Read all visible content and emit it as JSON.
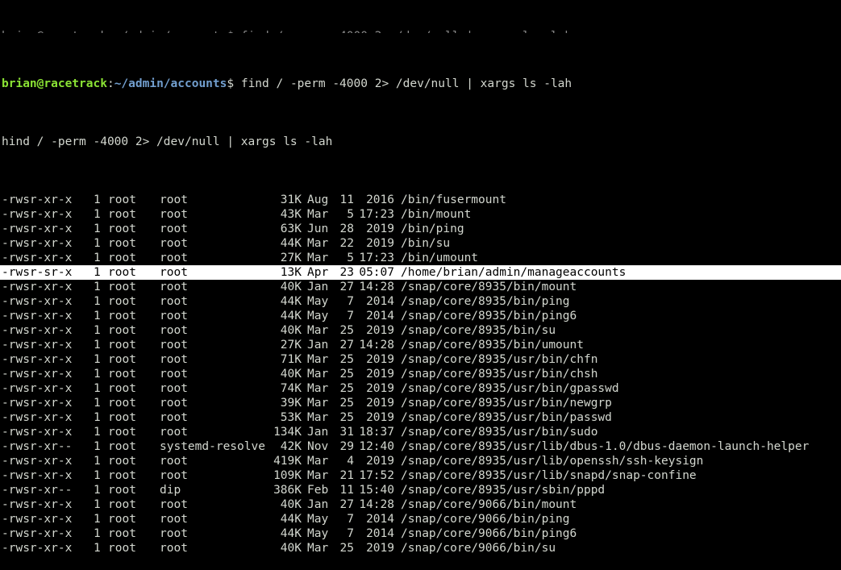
{
  "prompt": {
    "user_host": "brian@racetrack",
    "separator": ":",
    "path": "~/admin/accounts",
    "symbol": "$ ",
    "command": "find / -perm -4000 2> /dev/null | xargs ls -lah"
  },
  "echo_line": "hind / -perm -4000 2> /dev/null | xargs ls -lah",
  "partial_line": "brian@racetrack:~/admin/accounts$ find / -perm -4000 2> /dev/null | xargs ls -lah",
  "rows": [
    {
      "perm": "-rwsr-xr-x",
      "links": "1",
      "owner": "root",
      "group": "root",
      "size": "31K",
      "month": "Aug",
      "day": "11",
      "time": "2016",
      "path": "/bin/fusermount"
    },
    {
      "perm": "-rwsr-xr-x",
      "links": "1",
      "owner": "root",
      "group": "root",
      "size": "43K",
      "month": "Mar",
      "day": "5",
      "time": "17:23",
      "path": "/bin/mount"
    },
    {
      "perm": "-rwsr-xr-x",
      "links": "1",
      "owner": "root",
      "group": "root",
      "size": "63K",
      "month": "Jun",
      "day": "28",
      "time": "2019",
      "path": "/bin/ping"
    },
    {
      "perm": "-rwsr-xr-x",
      "links": "1",
      "owner": "root",
      "group": "root",
      "size": "44K",
      "month": "Mar",
      "day": "22",
      "time": "2019",
      "path": "/bin/su"
    },
    {
      "perm": "-rwsr-xr-x",
      "links": "1",
      "owner": "root",
      "group": "root",
      "size": "27K",
      "month": "Mar",
      "day": "5",
      "time": "17:23",
      "path": "/bin/umount"
    },
    {
      "perm": "-rwsr-sr-x",
      "links": "1",
      "owner": "root",
      "group": "root",
      "size": "13K",
      "month": "Apr",
      "day": "23",
      "time": "05:07",
      "path": "/home/brian/admin/manageaccounts",
      "highlight": true
    },
    {
      "perm": "-rwsr-xr-x",
      "links": "1",
      "owner": "root",
      "group": "root",
      "size": "40K",
      "month": "Jan",
      "day": "27",
      "time": "14:28",
      "path": "/snap/core/8935/bin/mount"
    },
    {
      "perm": "-rwsr-xr-x",
      "links": "1",
      "owner": "root",
      "group": "root",
      "size": "44K",
      "month": "May",
      "day": "7",
      "time": "2014",
      "path": "/snap/core/8935/bin/ping"
    },
    {
      "perm": "-rwsr-xr-x",
      "links": "1",
      "owner": "root",
      "group": "root",
      "size": "44K",
      "month": "May",
      "day": "7",
      "time": "2014",
      "path": "/snap/core/8935/bin/ping6"
    },
    {
      "perm": "-rwsr-xr-x",
      "links": "1",
      "owner": "root",
      "group": "root",
      "size": "40K",
      "month": "Mar",
      "day": "25",
      "time": "2019",
      "path": "/snap/core/8935/bin/su"
    },
    {
      "perm": "-rwsr-xr-x",
      "links": "1",
      "owner": "root",
      "group": "root",
      "size": "27K",
      "month": "Jan",
      "day": "27",
      "time": "14:28",
      "path": "/snap/core/8935/bin/umount"
    },
    {
      "perm": "-rwsr-xr-x",
      "links": "1",
      "owner": "root",
      "group": "root",
      "size": "71K",
      "month": "Mar",
      "day": "25",
      "time": "2019",
      "path": "/snap/core/8935/usr/bin/chfn"
    },
    {
      "perm": "-rwsr-xr-x",
      "links": "1",
      "owner": "root",
      "group": "root",
      "size": "40K",
      "month": "Mar",
      "day": "25",
      "time": "2019",
      "path": "/snap/core/8935/usr/bin/chsh"
    },
    {
      "perm": "-rwsr-xr-x",
      "links": "1",
      "owner": "root",
      "group": "root",
      "size": "74K",
      "month": "Mar",
      "day": "25",
      "time": "2019",
      "path": "/snap/core/8935/usr/bin/gpasswd"
    },
    {
      "perm": "-rwsr-xr-x",
      "links": "1",
      "owner": "root",
      "group": "root",
      "size": "39K",
      "month": "Mar",
      "day": "25",
      "time": "2019",
      "path": "/snap/core/8935/usr/bin/newgrp"
    },
    {
      "perm": "-rwsr-xr-x",
      "links": "1",
      "owner": "root",
      "group": "root",
      "size": "53K",
      "month": "Mar",
      "day": "25",
      "time": "2019",
      "path": "/snap/core/8935/usr/bin/passwd"
    },
    {
      "perm": "-rwsr-xr-x",
      "links": "1",
      "owner": "root",
      "group": "root",
      "size": "134K",
      "month": "Jan",
      "day": "31",
      "time": "18:37",
      "path": "/snap/core/8935/usr/bin/sudo"
    },
    {
      "perm": "-rwsr-xr--",
      "links": "1",
      "owner": "root",
      "group": "systemd-resolve",
      "size": "42K",
      "month": "Nov",
      "day": "29",
      "time": "12:40",
      "path": "/snap/core/8935/usr/lib/dbus-1.0/dbus-daemon-launch-helper"
    },
    {
      "perm": "-rwsr-xr-x",
      "links": "1",
      "owner": "root",
      "group": "root",
      "size": "419K",
      "month": "Mar",
      "day": "4",
      "time": "2019",
      "path": "/snap/core/8935/usr/lib/openssh/ssh-keysign"
    },
    {
      "perm": "-rwsr-xr-x",
      "links": "1",
      "owner": "root",
      "group": "root",
      "size": "109K",
      "month": "Mar",
      "day": "21",
      "time": "17:52",
      "path": "/snap/core/8935/usr/lib/snapd/snap-confine"
    },
    {
      "perm": "-rwsr-xr--",
      "links": "1",
      "owner": "root",
      "group": "dip",
      "size": "386K",
      "month": "Feb",
      "day": "11",
      "time": "15:40",
      "path": "/snap/core/8935/usr/sbin/pppd"
    },
    {
      "perm": "-rwsr-xr-x",
      "links": "1",
      "owner": "root",
      "group": "root",
      "size": "40K",
      "month": "Jan",
      "day": "27",
      "time": "14:28",
      "path": "/snap/core/9066/bin/mount"
    },
    {
      "perm": "-rwsr-xr-x",
      "links": "1",
      "owner": "root",
      "group": "root",
      "size": "44K",
      "month": "May",
      "day": "7",
      "time": "2014",
      "path": "/snap/core/9066/bin/ping"
    },
    {
      "perm": "-rwsr-xr-x",
      "links": "1",
      "owner": "root",
      "group": "root",
      "size": "44K",
      "month": "May",
      "day": "7",
      "time": "2014",
      "path": "/snap/core/9066/bin/ping6"
    },
    {
      "perm": "-rwsr-xr-x",
      "links": "1",
      "owner": "root",
      "group": "root",
      "size": "40K",
      "month": "Mar",
      "day": "25",
      "time": "2019",
      "path": "/snap/core/9066/bin/su"
    }
  ],
  "colors": {
    "background": "#000000",
    "foreground": "#d3d7cf",
    "prompt_user": "#8ae234",
    "prompt_path": "#729fcf",
    "highlight_bg": "#ffffff",
    "highlight_fg": "#000000"
  }
}
